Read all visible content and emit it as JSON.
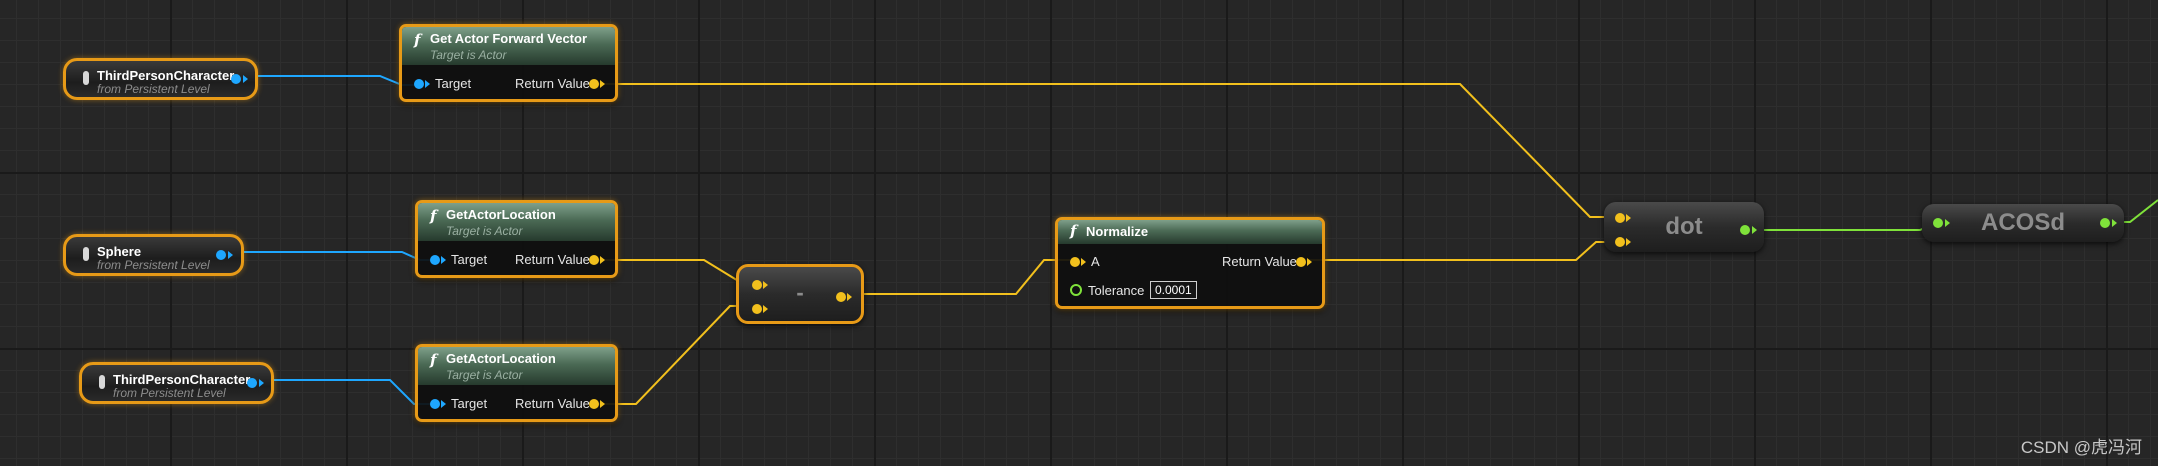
{
  "variables": {
    "tpc1": {
      "name": "ThirdPersonCharacter",
      "from": "from Persistent Level"
    },
    "sphere": {
      "name": "Sphere",
      "from": "from Persistent Level"
    },
    "tpc2": {
      "name": "ThirdPersonCharacter",
      "from": "from Persistent Level"
    }
  },
  "nodes": {
    "forward": {
      "icon": "function-icon",
      "symbol": "f",
      "title": "Get Actor Forward Vector",
      "subtitle": "Target is Actor",
      "in_label": "Target",
      "out_label": "Return Value"
    },
    "loc1": {
      "icon": "function-icon",
      "symbol": "f",
      "title": "GetActorLocation",
      "subtitle": "Target is Actor",
      "in_label": "Target",
      "out_label": "Return Value"
    },
    "loc2": {
      "icon": "function-icon",
      "symbol": "f",
      "title": "GetActorLocation",
      "subtitle": "Target is Actor",
      "in_label": "Target",
      "out_label": "Return Value"
    },
    "subtract": {
      "label": "-"
    },
    "normalize": {
      "icon": "function-icon",
      "symbol": "f",
      "title": "Normalize",
      "in_label": "A",
      "tolerance_label": "Tolerance",
      "tolerance_value": "0.0001",
      "out_label": "Return Value"
    },
    "dot": {
      "label": "dot"
    },
    "acos": {
      "label": "ACOSd"
    }
  },
  "colors": {
    "object_pin": "#1ea7ff",
    "vector_pin": "#f2c01d",
    "float_pin": "#7fe23a",
    "selection_outline": "#e79a17"
  },
  "watermark": "CSDN @虎冯河"
}
